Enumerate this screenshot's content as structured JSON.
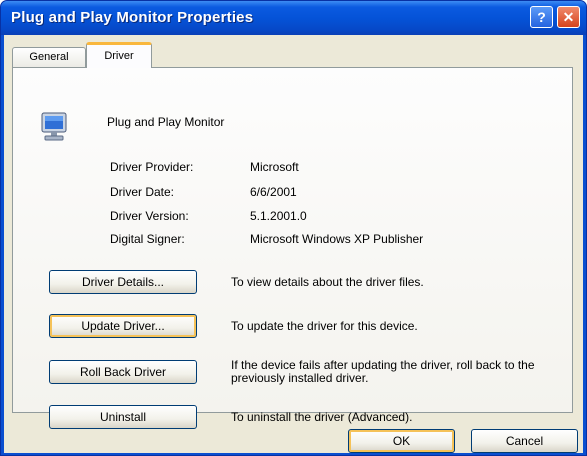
{
  "window": {
    "title": "Plug and Play Monitor Properties",
    "help_glyph": "?",
    "close_glyph": "✕"
  },
  "tabs": [
    {
      "label": "General"
    },
    {
      "label": "Driver"
    }
  ],
  "device": {
    "name": "Plug and Play Monitor",
    "icon": "monitor-icon"
  },
  "details": [
    {
      "label": "Driver Provider:",
      "value": "Microsoft"
    },
    {
      "label": "Driver Date:",
      "value": "6/6/2001"
    },
    {
      "label": "Driver Version:",
      "value": "5.1.2001.0"
    },
    {
      "label": "Digital Signer:",
      "value": "Microsoft Windows XP Publisher"
    }
  ],
  "actions": [
    {
      "label": "Driver Details...",
      "description": "To view details about the driver files."
    },
    {
      "label": "Update Driver...",
      "description": "To update the driver for this device."
    },
    {
      "label": "Roll Back Driver",
      "description": "If the device fails after updating the driver, roll back to the previously installed driver."
    },
    {
      "label": "Uninstall",
      "description": "To uninstall the driver (Advanced)."
    }
  ],
  "footer": {
    "ok_label": "OK",
    "cancel_label": "Cancel"
  },
  "colors": {
    "titlebar": "#0553d8",
    "dialog_bg": "#ece9d8",
    "button_border": "#003c74",
    "focus_ring": "#f5c258",
    "tab_accent": "#f9b73d"
  }
}
